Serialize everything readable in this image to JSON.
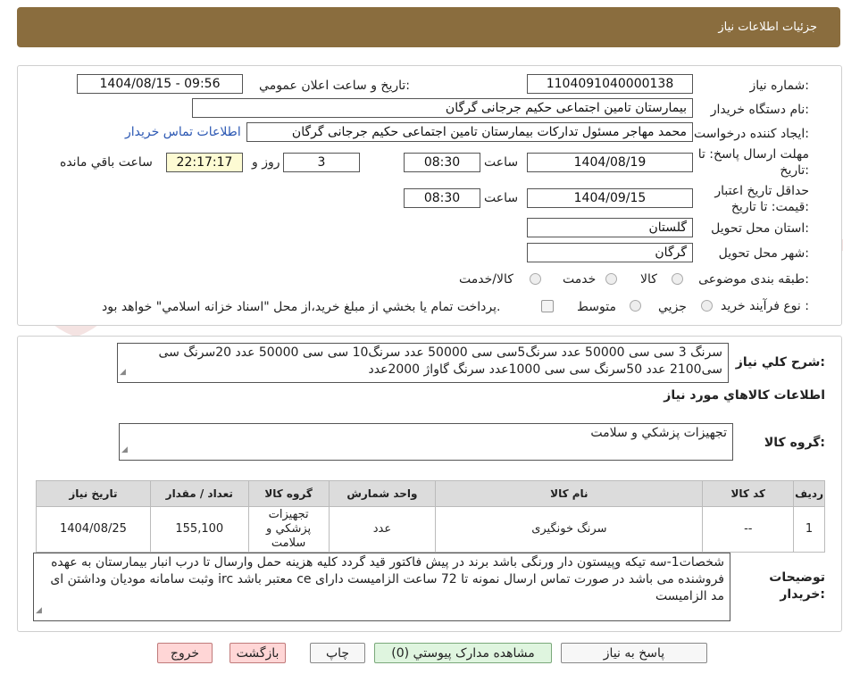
{
  "header": {
    "title": "جزئیات اطلاعات نیاز"
  },
  "watermark": {
    "text": "AriaTender.neT"
  },
  "form": {
    "need_number_label": "شماره نیاز:",
    "need_number": "1104091040000138",
    "announce_label": "تاریخ و ساعت اعلان عمومي:",
    "announce_value": "1404/08/15 - 09:56",
    "buyer_org_label": "نام دستگاه خريدار:",
    "buyer_org": "بیمارستان تامین اجتماعی حکیم جرجانی گرگان",
    "requester_label": "ايجاد كننده درخواست:",
    "requester": "محمد مهاجر مسئول تدارکات بیمارستان تامین اجتماعی حکیم جرجانی گرگان",
    "contact_link": "اطلاعات تماس خريدار",
    "deadline_label_1": "مهلت ارسال پاسخ: تا",
    "deadline_label_2": "تاريخ:",
    "deadline_date": "1404/08/19",
    "time_label": "ساعت",
    "deadline_time": "08:30",
    "days_value": "3",
    "days_label": "روز و",
    "remaining_time": "22:17:17",
    "remaining_label": "ساعت باقي مانده",
    "validity_label_1": "حداقل تاريخ اعتبار",
    "validity_label_2": "قيمت: تا تاريخ:",
    "validity_date": "1404/09/15",
    "validity_time": "08:30",
    "province_label": "استان محل تحويل:",
    "province": "گلستان",
    "city_label": "شهر محل تحويل:",
    "city": "گرگان",
    "category_label": "طبقه بندی موضوعی:",
    "category_options": [
      "كالا",
      "خدمت",
      "كالا/خدمت"
    ],
    "process_label": "نوع فرآيند خريد :",
    "process_options": [
      "جزيي",
      "متوسط"
    ],
    "payment_note": "پرداخت تمام يا بخشي از مبلغ خريد،از محل \"اسناد خزانه اسلامي\" خواهد بود."
  },
  "summary": {
    "label": "شرح كلي نياز:",
    "text": "سرنگ 3 سی سی 50000 عدد سرنگ5سی سی 50000 عدد سرنگ10 سی سی 50000 عدد 20سرنگ سی سی2100 عدد 50سرنگ سی سی 1000عدد سرنگ گاواژ 2000عدد",
    "items_heading": "اطلاعات كالاهاي مورد نياز",
    "goods_group_label": "گروه كالا:",
    "goods_group": "تجهيزات پزشكي و سلامت"
  },
  "table": {
    "headers": [
      "رديف",
      "كد كالا",
      "نام كالا",
      "واحد شمارش",
      "گروه كالا",
      "تعداد / مقدار",
      "تاريخ نياز"
    ],
    "rows": [
      [
        "1",
        "--",
        "سرنگ خونگیری",
        "عدد",
        "تجهيزات پزشكي و سلامت",
        "155,100",
        "1404/08/25"
      ]
    ]
  },
  "buyer_notes": {
    "label": "توضيحات خريدار:",
    "text": "شخصات1-سه تیکه وپیستون دار ورنگی باشد  برند در پیش فاکتور قید گردد کلیه هزینه حمل وارسال تا درب انبار بیمارستان به عهده فروشنده می باشد در صورت تماس ارسال نمونه تا 72 ساعت الزامیست دارای ce معتبر باشد irc وثبت سامانه مودیان وداشتن ای مد الزامیست"
  },
  "buttons": {
    "reply": "پاسخ به نياز",
    "attachments": "مشاهده مدارک پيوستي (0)",
    "print": "چاپ",
    "back": "بازگشت",
    "exit": "خروج"
  }
}
